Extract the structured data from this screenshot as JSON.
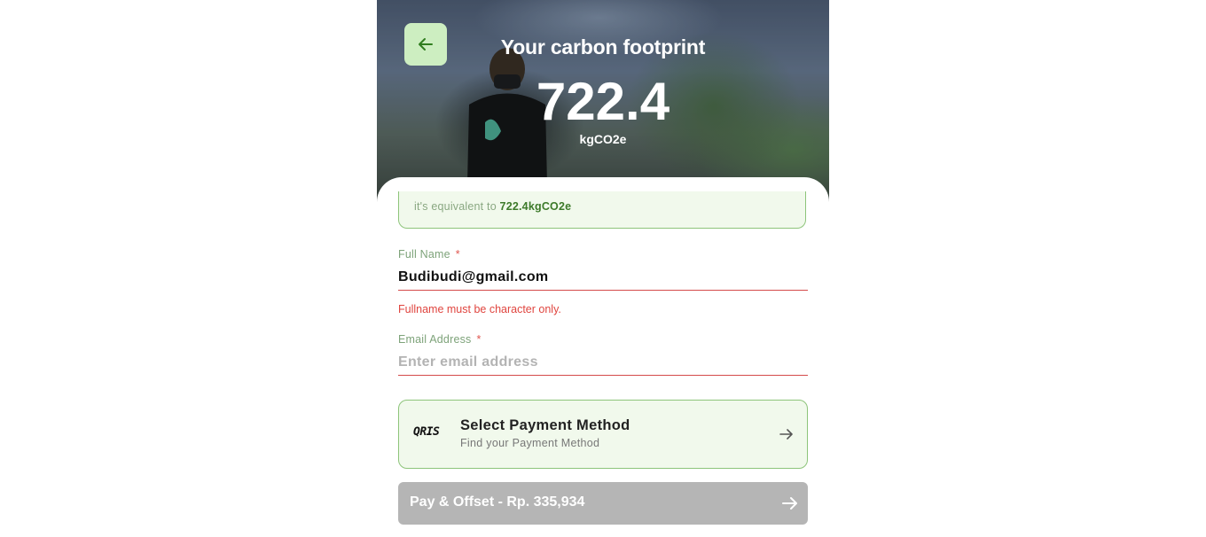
{
  "header": {
    "title": "Your carbon footprint",
    "value": "722.4",
    "unit": "kgCO2e"
  },
  "summary": {
    "prefix": "it's equivalent to",
    "amount": "722.4kgCO2e"
  },
  "form": {
    "full_name": {
      "label": "Full Name",
      "required_mark": "*",
      "value": "Budibudi@gmail.com",
      "error": "Fullname must be character only."
    },
    "email": {
      "label": "Email Address",
      "required_mark": "*",
      "value": "",
      "placeholder": "Enter email address"
    }
  },
  "payment_method": {
    "logo_text": "QRIS",
    "title": "Select Payment Method",
    "subtitle": "Find your Payment Method"
  },
  "pay_button": {
    "label": "Pay & Offset - Rp. 335,934"
  },
  "icons": {
    "back": "arrow-left-icon",
    "payment_arrow": "arrow-right-icon",
    "pay_arrow": "arrow-right-icon"
  },
  "colors": {
    "accent_green": "#8dc47a",
    "back_button_bg": "#cdeec1",
    "error_red": "#e0453f",
    "disabled_button": "#b5b5b5"
  }
}
